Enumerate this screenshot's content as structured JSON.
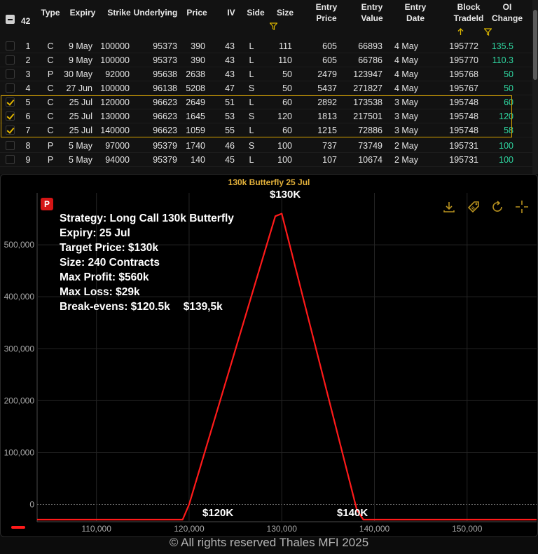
{
  "table": {
    "select_all_count": "42",
    "columns": [
      {
        "key": "type",
        "label": [
          "Type"
        ]
      },
      {
        "key": "expiry",
        "label": [
          "Expiry"
        ]
      },
      {
        "key": "strike",
        "label": [
          "Strike"
        ]
      },
      {
        "key": "underlying",
        "label": [
          "Underlying"
        ]
      },
      {
        "key": "price",
        "label": [
          "Price"
        ]
      },
      {
        "key": "iv",
        "label": [
          "IV"
        ]
      },
      {
        "key": "side",
        "label": [
          "Side"
        ]
      },
      {
        "key": "size",
        "label": [
          "Size"
        ]
      },
      {
        "key": "entry_price",
        "label": [
          "Entry",
          "Price"
        ]
      },
      {
        "key": "entry_value",
        "label": [
          "Entry",
          "Value"
        ]
      },
      {
        "key": "entry_date",
        "label": [
          "Entry",
          "Date"
        ]
      },
      {
        "key": "block_tradeid",
        "label": [
          "Block",
          "TradeId"
        ]
      },
      {
        "key": "oi_change",
        "label": [
          "OI",
          "Change"
        ]
      }
    ],
    "rows": [
      {
        "num": "1",
        "type": "C",
        "expiry": "9 May",
        "strike": "100000",
        "underlying": "95373",
        "price": "390",
        "iv": "43",
        "side": "L",
        "size": "111",
        "entry_price": "605",
        "entry_value": "66893",
        "entry_date": "4 May",
        "block_tradeid": "195772",
        "oi_change": "135.5",
        "checked": false
      },
      {
        "num": "2",
        "type": "C",
        "expiry": "9 May",
        "strike": "100000",
        "underlying": "95373",
        "price": "390",
        "iv": "43",
        "side": "L",
        "size": "110",
        "entry_price": "605",
        "entry_value": "66786",
        "entry_date": "4 May",
        "block_tradeid": "195770",
        "oi_change": "110.3",
        "checked": false
      },
      {
        "num": "3",
        "type": "P",
        "expiry": "30 May",
        "strike": "92000",
        "underlying": "95638",
        "price": "2638",
        "iv": "43",
        "side": "L",
        "size": "50",
        "entry_price": "2479",
        "entry_value": "123947",
        "entry_date": "4 May",
        "block_tradeid": "195768",
        "oi_change": "50",
        "checked": false
      },
      {
        "num": "4",
        "type": "C",
        "expiry": "27 Jun",
        "strike": "100000",
        "underlying": "96138",
        "price": "5208",
        "iv": "47",
        "side": "S",
        "size": "50",
        "entry_price": "5437",
        "entry_value": "271827",
        "entry_date": "4 May",
        "block_tradeid": "195767",
        "oi_change": "50",
        "checked": false
      },
      {
        "num": "5",
        "type": "C",
        "expiry": "25 Jul",
        "strike": "120000",
        "underlying": "96623",
        "price": "2649",
        "iv": "51",
        "side": "L",
        "size": "60",
        "entry_price": "2892",
        "entry_value": "173538",
        "entry_date": "3 May",
        "block_tradeid": "195748",
        "oi_change": "60",
        "checked": true
      },
      {
        "num": "6",
        "type": "C",
        "expiry": "25 Jul",
        "strike": "130000",
        "underlying": "96623",
        "price": "1645",
        "iv": "53",
        "side": "S",
        "size": "120",
        "entry_price": "1813",
        "entry_value": "217501",
        "entry_date": "3 May",
        "block_tradeid": "195748",
        "oi_change": "120",
        "checked": true
      },
      {
        "num": "7",
        "type": "C",
        "expiry": "25 Jul",
        "strike": "140000",
        "underlying": "96623",
        "price": "1059",
        "iv": "55",
        "side": "L",
        "size": "60",
        "entry_price": "1215",
        "entry_value": "72886",
        "entry_date": "3 May",
        "block_tradeid": "195748",
        "oi_change": "58",
        "checked": true
      },
      {
        "num": "8",
        "type": "P",
        "expiry": "5 May",
        "strike": "97000",
        "underlying": "95379",
        "price": "1740",
        "iv": "46",
        "side": "S",
        "size": "100",
        "entry_price": "737",
        "entry_value": "73749",
        "entry_date": "2 May",
        "block_tradeid": "195731",
        "oi_change": "100",
        "checked": false
      },
      {
        "num": "9",
        "type": "P",
        "expiry": "5 May",
        "strike": "94000",
        "underlying": "95379",
        "price": "140",
        "iv": "45",
        "side": "L",
        "size": "100",
        "entry_price": "107",
        "entry_value": "10674",
        "entry_date": "2 May",
        "block_tradeid": "195731",
        "oi_change": "100",
        "checked": false
      }
    ]
  },
  "chart": {
    "title": "130k Butterfly 25 Jul",
    "badge": "P",
    "toolbar": [
      "download-icon",
      "tag-icon",
      "reset-icon",
      "crosshair-icon"
    ],
    "info_lines": [
      "Strategy: Long Call 130k Butterfly",
      "Expiry: 25 Jul",
      "Target Price: $130k",
      "Size: 240 Contracts",
      "Max Profit: $560k",
      "Max Loss: $29k"
    ],
    "breakevens_label": "Break-evens: $120.5k",
    "breakevens_second": "$139,5k",
    "annotations": {
      "peak": "$130K",
      "low_left": "$120K",
      "low_right": "$140K"
    },
    "accent_color": "#ff1a1a",
    "title_color": "#e3b13a"
  },
  "chart_data": {
    "type": "line",
    "title": "130k Butterfly 25 Jul",
    "xlabel": "",
    "ylabel": "",
    "x_ticks": [
      110000,
      120000,
      130000,
      140000,
      150000
    ],
    "y_ticks": [
      0,
      100000,
      200000,
      300000,
      400000,
      500000
    ],
    "x_tick_labels": [
      "110,000",
      "120,000",
      "130,000",
      "140,000",
      "150,000"
    ],
    "y_tick_labels": [
      "0",
      "100,000",
      "200,000",
      "300,000",
      "400,000",
      "500,000"
    ],
    "xlim": [
      103600,
      157500
    ],
    "ylim": [
      -33000,
      600000
    ],
    "series": [
      {
        "color": "#ff1a1a",
        "x": [
          103600,
          119300,
          120000,
          129300,
          130000,
          138100,
          138800,
          157500
        ],
        "y": [
          -29000,
          -29000,
          0,
          555000,
          560000,
          -10000,
          -29000,
          -29000
        ]
      }
    ],
    "grid": true,
    "zero_line": true,
    "legend": "bottom-left"
  },
  "footer": "© All rights reserved Thales MFI 2025"
}
